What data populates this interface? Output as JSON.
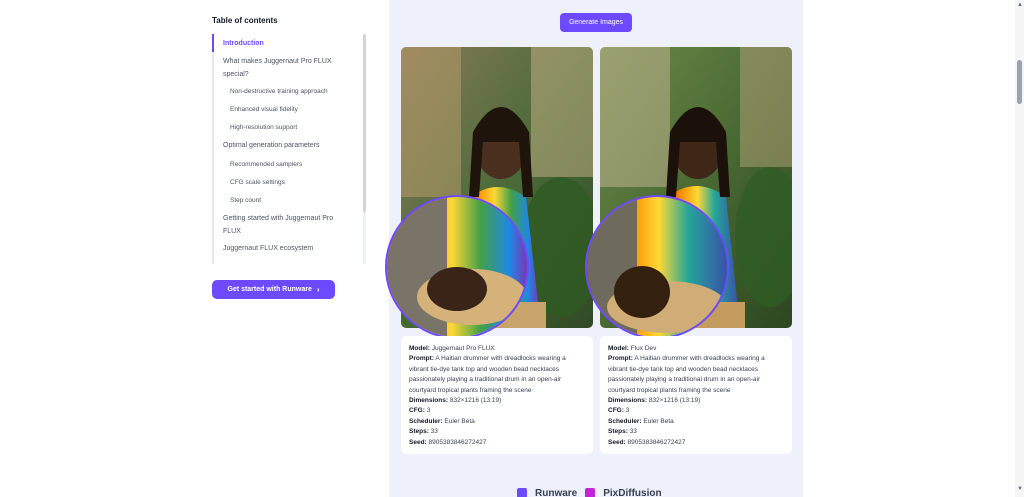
{
  "toc": {
    "title": "Table of contents",
    "items": [
      {
        "label": "Introduction",
        "level": 1,
        "active": true
      },
      {
        "label": "What makes Juggernaut Pro FLUX special?",
        "level": 1
      },
      {
        "label": "Non-destructive training approach",
        "level": 2
      },
      {
        "label": "Enhanced visual fidelity",
        "level": 2
      },
      {
        "label": "High-resolution support",
        "level": 2
      },
      {
        "label": "Optimal generation parameters",
        "level": 1
      },
      {
        "label": "Recommended samplers",
        "level": 2
      },
      {
        "label": "CFG scale settings",
        "level": 2
      },
      {
        "label": "Step count",
        "level": 2
      },
      {
        "label": "Getting started with Juggernaut Pro FLUX",
        "level": 1
      },
      {
        "label": "Juggernaut FLUX ecosystem",
        "level": 1
      }
    ]
  },
  "cta": {
    "label": "Get started with Runware",
    "icon": "chevron-right-icon"
  },
  "main": {
    "generate_label": "Generate Images",
    "cards": [
      {
        "model_label": "Model:",
        "model": "Juggernaut Pro FLUX",
        "prompt_label": "Prompt:",
        "prompt": "A Haitian drummer with dreadlocks wearing a vibrant tie-dye tank top and wooden bead necklaces passionately playing a traditional drum in an open-air courtyard tropical plants framing the scene",
        "dimensions_label": "Dimensions:",
        "dimensions": "832×1216 (13:19)",
        "cfg_label": "CFG:",
        "cfg": "3",
        "scheduler_label": "Scheduler:",
        "scheduler": "Euler Beta",
        "steps_label": "Steps:",
        "steps": "33",
        "seed_label": "Seed:",
        "seed": "8905383846272427"
      },
      {
        "model_label": "Model:",
        "model": "Flux Dev",
        "prompt_label": "Prompt:",
        "prompt": "A Haitian drummer with dreadlocks wearing a vibrant tie-dye tank top and wooden bead necklaces passionately playing a traditional drum in an open-air courtyard tropical plants framing the scene",
        "dimensions_label": "Dimensions:",
        "dimensions": "832×1216 (13:19)",
        "cfg_label": "CFG:",
        "cfg": "3",
        "scheduler_label": "Scheduler:",
        "scheduler": "Euler Beta",
        "steps_label": "Steps:",
        "steps": "33",
        "seed_label": "Seed:",
        "seed": "8905383846272427"
      }
    ]
  },
  "footer": {
    "brand_left": "Runware",
    "brand_right": "PixDiffusion"
  },
  "colors": {
    "accent": "#6d4aff",
    "panel_bg": "#eef0fb"
  }
}
